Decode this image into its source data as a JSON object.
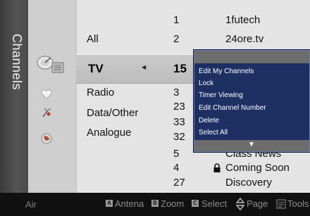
{
  "rail": {
    "title": "Channels"
  },
  "categories": {
    "all": "All",
    "tv": "TV",
    "radio": "Radio",
    "data_other": "Data/Other",
    "analogue": "Analogue"
  },
  "channels": [
    {
      "number": "1",
      "name": "1futech"
    },
    {
      "number": "2",
      "name": "24ore.tv"
    },
    {
      "number": "15",
      "name": ""
    },
    {
      "number": "3",
      "name": ""
    },
    {
      "number": "23",
      "name": ""
    },
    {
      "number": "33",
      "name": ""
    },
    {
      "number": "32",
      "name": ""
    },
    {
      "number": "5",
      "name": "Class News"
    },
    {
      "number": "4",
      "name": "Coming Soon"
    },
    {
      "number": "27",
      "name": "Discovery"
    }
  ],
  "popup_menu": {
    "items": [
      "Edit My Channels",
      "Lock",
      "Timer Viewing",
      "Edit Channel Number",
      "Delete",
      "Select All"
    ]
  },
  "bottom_bar": {
    "mode": "Air",
    "buttons": [
      {
        "key": "A",
        "label": "Antena"
      },
      {
        "key": "B",
        "label": "Zoom"
      },
      {
        "key": "C",
        "label": "Select"
      },
      {
        "key": "",
        "label": "Page"
      },
      {
        "key": "",
        "label": "Tools"
      }
    ]
  },
  "icons": {
    "satellite": "satellite-dish-icon",
    "favorite": "heart-icon",
    "antenna": "antenna-icon",
    "globe": "globe-icon",
    "lock": "lock-icon",
    "updown": "updown-arrow-icon",
    "tools": "tools-icon"
  },
  "colors": {
    "popup_bg": "#1d2f63",
    "selection_bg": "#c4c4c4",
    "rail_bg": "#4a4a4a",
    "bottom_bg": "#111111"
  }
}
